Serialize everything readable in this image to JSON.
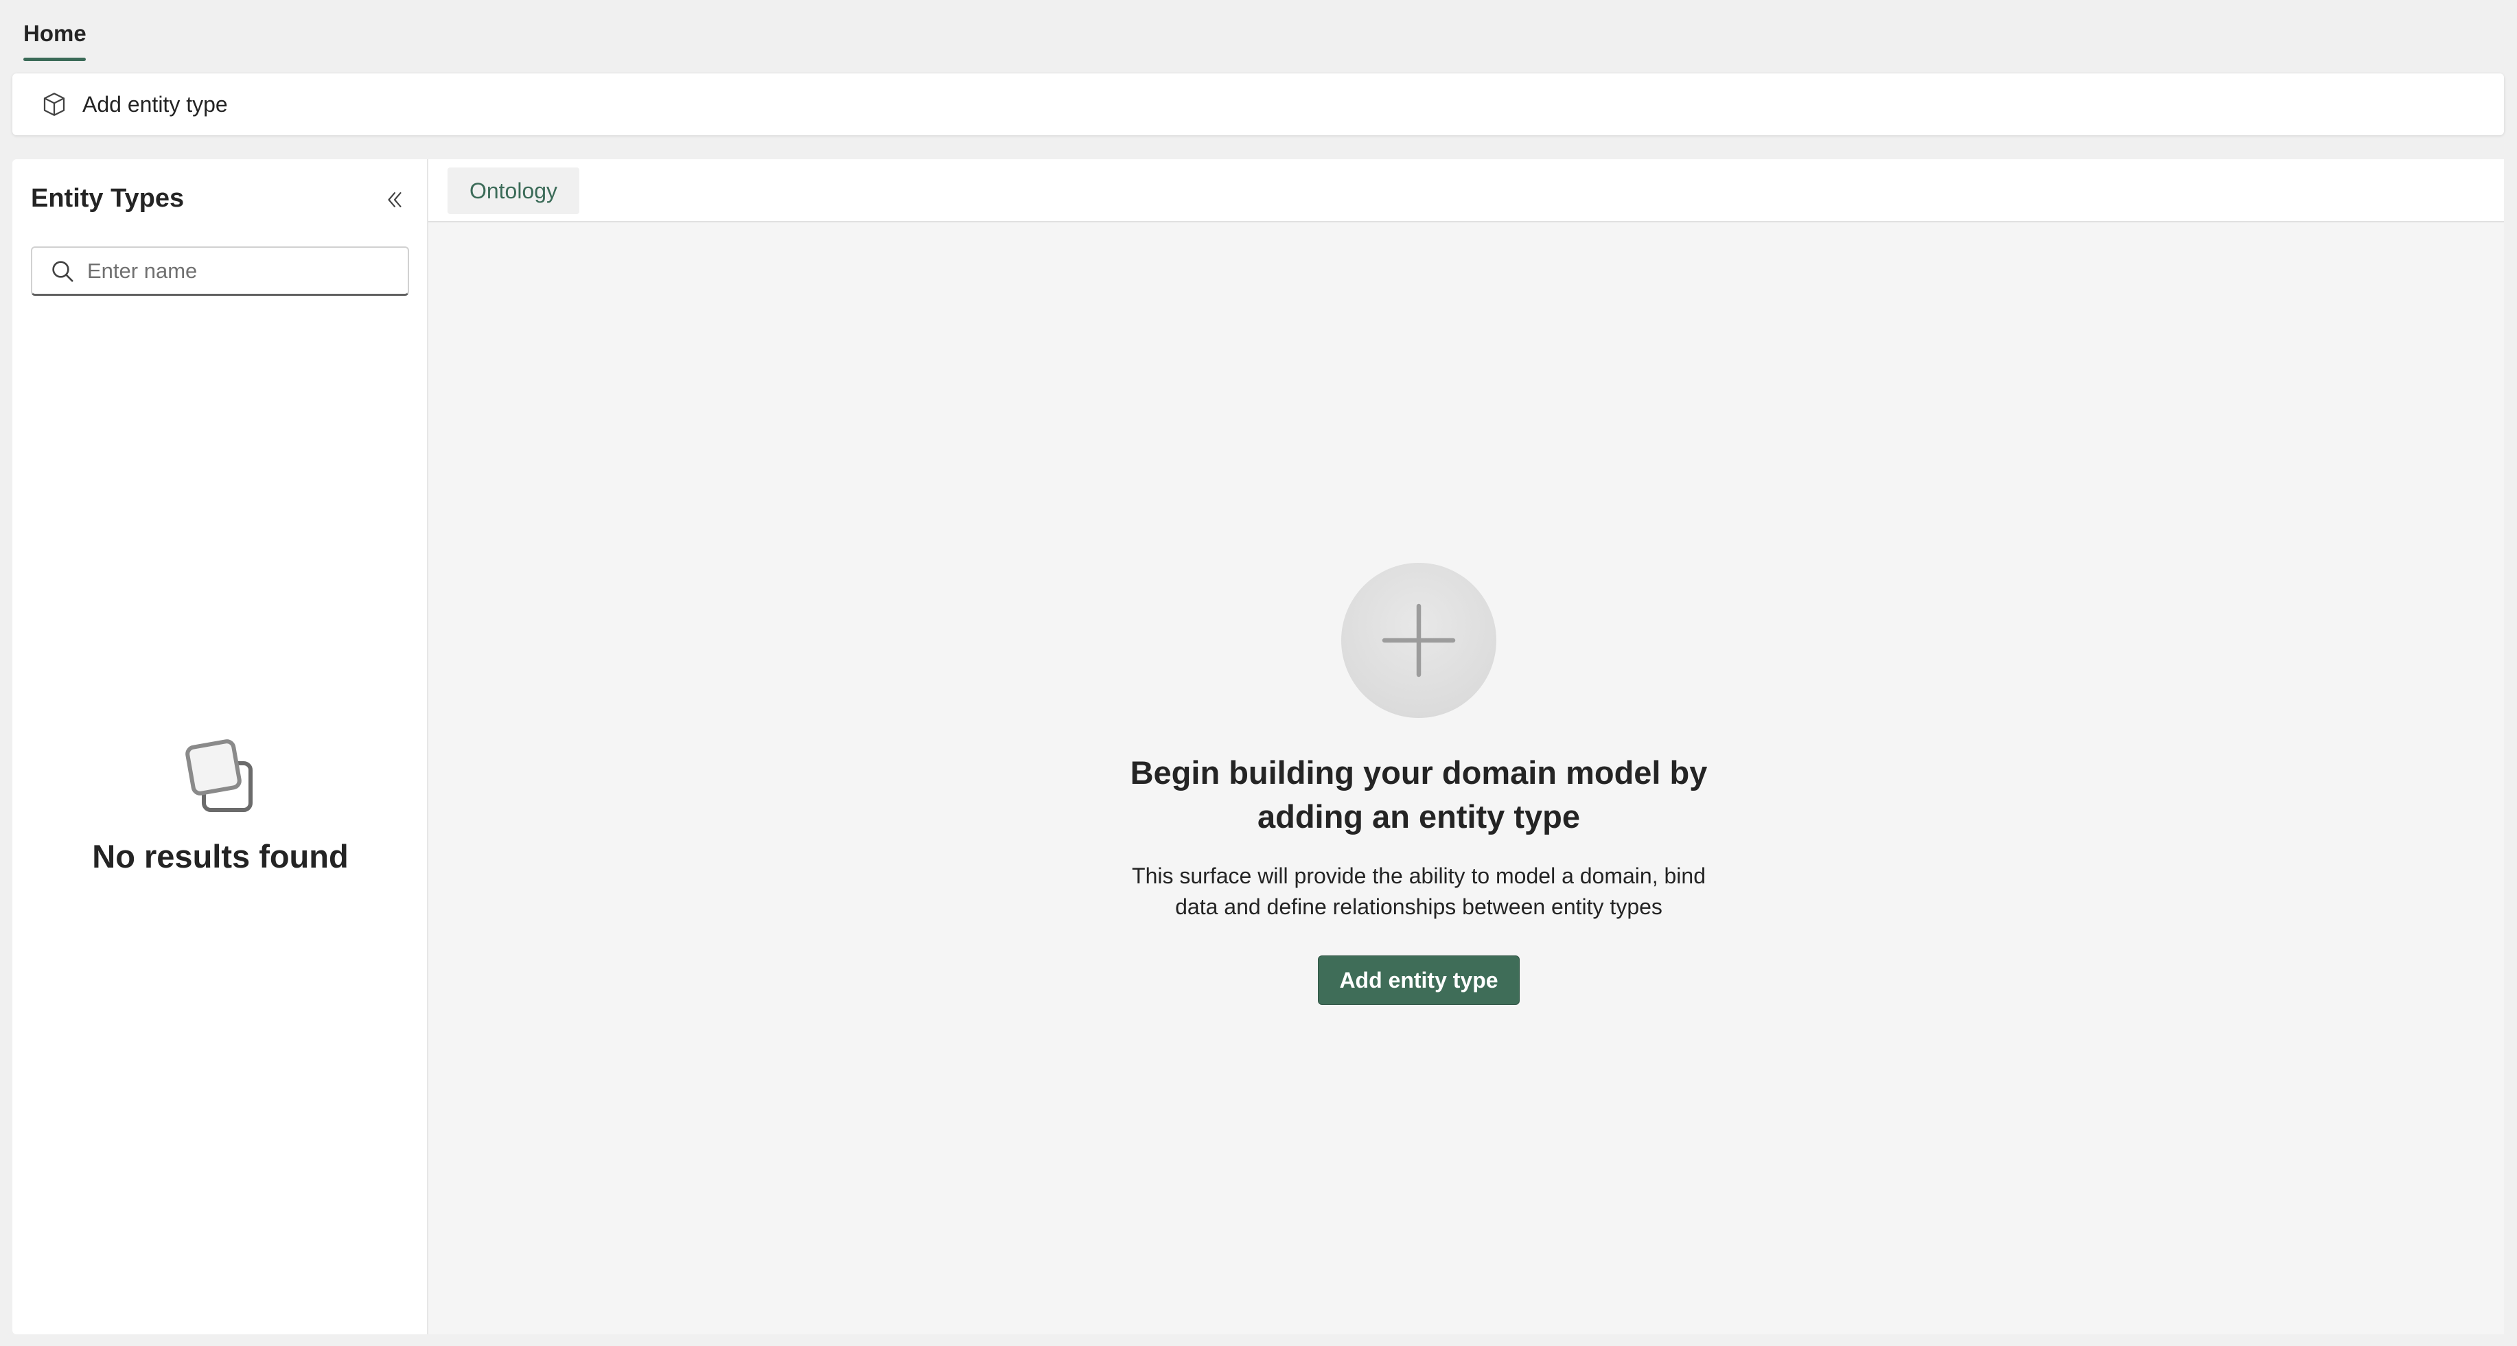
{
  "top_tabs": [
    {
      "label": "Home",
      "active": true
    }
  ],
  "toolbar": {
    "add_entity_type_label": "Add entity type"
  },
  "sidebar": {
    "title": "Entity Types",
    "search": {
      "placeholder": "Enter name",
      "value": ""
    },
    "empty_message": "No results found"
  },
  "main": {
    "tabs": [
      {
        "label": "Ontology",
        "active": true
      }
    ],
    "empty_state": {
      "title": "Begin building your domain model by adding an entity type",
      "description": "This surface will provide the ability to model a domain, bind data and define relationships between entity types",
      "button_label": "Add entity type"
    }
  },
  "colors": {
    "accent": "#3f6d58",
    "accent_text": "#3b6b58"
  },
  "icons": {
    "toolbar": "cube-icon",
    "collapse": "chevron-double-left-icon",
    "search": "search-icon",
    "empty_left": "stacked-squares-icon",
    "empty_main": "plus-icon"
  }
}
